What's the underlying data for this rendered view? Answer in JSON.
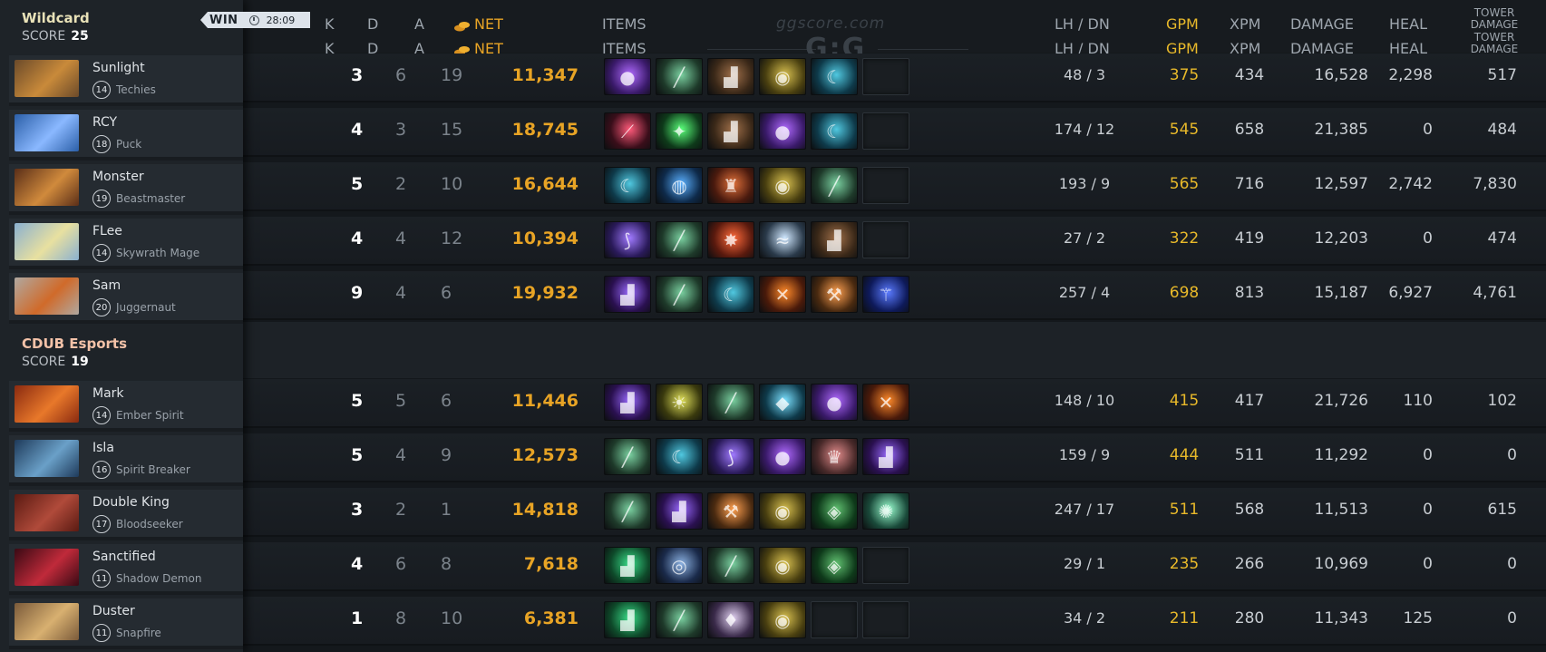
{
  "colors": {
    "gold": "#e8a425",
    "gpm": "#e8b92a",
    "team1_name": "#e9e2b8",
    "team2_name": "#f3c2a8"
  },
  "match": {
    "result": "WIN",
    "duration": "28:09"
  },
  "headers": {
    "k": "K",
    "d": "D",
    "a": "A",
    "net": "NET",
    "items": "ITEMS",
    "lhdn": "LH / DN",
    "gpm": "GPM",
    "xpm": "XPM",
    "damage": "DAMAGE",
    "heal": "HEAL",
    "tower_line1": "TOWER",
    "tower_line2": "DAMAGE"
  },
  "watermark": {
    "text": "ggscore.com",
    "logo": "G:G",
    "logo_sub": "ggscore.com"
  },
  "teams": [
    {
      "name": "Wildcard",
      "score_label": "SCORE",
      "score": "25",
      "players": [
        {
          "name": "Sunlight",
          "level": "14",
          "hero": "Techies",
          "k": "3",
          "d": "6",
          "a": "19",
          "net": "11,347",
          "lhdn": "48 / 3",
          "gpm": "375",
          "xpm": "434",
          "damage": "16,528",
          "heal": "2,298",
          "tower": "517",
          "portrait": [
            "#6b4a2a",
            "#c98a3a"
          ],
          "items": [
            "orb-item-icon",
            "staff-item-icon",
            "boots-item-icon",
            "mask-item-icon",
            "blade-item-icon",
            "empty"
          ]
        },
        {
          "name": "RCY",
          "level": "18",
          "hero": "Puck",
          "k": "4",
          "d": "3",
          "a": "15",
          "net": "18,745",
          "lhdn": "174 / 12",
          "gpm": "545",
          "xpm": "658",
          "damage": "21,385",
          "heal": "0",
          "tower": "484",
          "portrait": [
            "#2b5fa8",
            "#8ab8ff"
          ],
          "items": [
            "dagger-item-icon",
            "gem-item-icon",
            "boots-item-icon",
            "orb-item-icon",
            "blade-item-icon",
            "empty"
          ]
        },
        {
          "name": "Monster",
          "level": "19",
          "hero": "Beastmaster",
          "k": "5",
          "d": "2",
          "a": "10",
          "net": "16,644",
          "lhdn": "193 / 9",
          "gpm": "565",
          "xpm": "716",
          "damage": "12,597",
          "heal": "2,742",
          "tower": "7,830",
          "portrait": [
            "#5a2e18",
            "#d08a3c"
          ],
          "items": [
            "blade-item-icon",
            "globe-item-icon",
            "helm-item-icon",
            "mask-item-icon",
            "staff-item-icon",
            "empty"
          ]
        },
        {
          "name": "FLee",
          "level": "14",
          "hero": "Skywrath Mage",
          "k": "4",
          "d": "4",
          "a": "12",
          "net": "10,394",
          "lhdn": "27 / 2",
          "gpm": "322",
          "xpm": "419",
          "damage": "12,203",
          "heal": "0",
          "tower": "474",
          "portrait": [
            "#8ab0d0",
            "#e8e0a0"
          ],
          "items": [
            "scythe-item-icon",
            "staff-item-icon",
            "shield-item-icon",
            "wind-item-icon",
            "boots-item-icon",
            "empty"
          ]
        },
        {
          "name": "Sam",
          "level": "20",
          "hero": "Juggernaut",
          "k": "9",
          "d": "4",
          "a": "6",
          "net": "19,932",
          "lhdn": "257 / 4",
          "gpm": "698",
          "xpm": "813",
          "damage": "15,187",
          "heal": "6,927",
          "tower": "4,761",
          "portrait": [
            "#b0a8a0",
            "#d06a2a"
          ],
          "items": [
            "boots-purple-item-icon",
            "staff-item-icon",
            "blade-item-icon",
            "crossed-blades-item-icon",
            "axe-item-icon",
            "scepter-item-icon"
          ]
        }
      ]
    },
    {
      "name": "CDUB Esports",
      "score_label": "SCORE",
      "score": "19",
      "players": [
        {
          "name": "Mark",
          "level": "14",
          "hero": "Ember Spirit",
          "k": "5",
          "d": "5",
          "a": "6",
          "net": "11,446",
          "lhdn": "148 / 10",
          "gpm": "415",
          "xpm": "417",
          "damage": "21,726",
          "heal": "110",
          "tower": "102",
          "portrait": [
            "#8a2a10",
            "#e8782a"
          ],
          "items": [
            "boots-purple-item-icon",
            "radiance-item-icon",
            "staff-item-icon",
            "crystal-item-icon",
            "orb-item-icon",
            "crossed-blades-item-icon"
          ]
        },
        {
          "name": "Isla",
          "level": "16",
          "hero": "Spirit Breaker",
          "k": "5",
          "d": "4",
          "a": "9",
          "net": "12,573",
          "lhdn": "159 / 9",
          "gpm": "444",
          "xpm": "511",
          "damage": "11,292",
          "heal": "0",
          "tower": "0",
          "portrait": [
            "#1e3a5a",
            "#6aa0c8"
          ],
          "items": [
            "staff-item-icon",
            "blade-item-icon",
            "scythe-item-icon",
            "orb-item-icon",
            "armor-item-icon",
            "boots-purple-item-icon"
          ]
        },
        {
          "name": "Double King",
          "level": "17",
          "hero": "Bloodseeker",
          "k": "3",
          "d": "2",
          "a": "1",
          "net": "14,818",
          "lhdn": "247 / 17",
          "gpm": "511",
          "xpm": "568",
          "damage": "11,513",
          "heal": "0",
          "tower": "615",
          "portrait": [
            "#5a1a12",
            "#b04a3a"
          ],
          "items": [
            "staff-item-icon",
            "boots-purple-item-icon",
            "axe-item-icon",
            "mask-item-icon",
            "cloak-item-icon",
            "spark-item-icon"
          ]
        },
        {
          "name": "Sanctified",
          "level": "11",
          "hero": "Shadow Demon",
          "k": "4",
          "d": "6",
          "a": "8",
          "net": "7,618",
          "lhdn": "29 / 1",
          "gpm": "235",
          "xpm": "266",
          "damage": "10,969",
          "heal": "0",
          "tower": "0",
          "portrait": [
            "#3a0a14",
            "#c02a3a"
          ],
          "items": [
            "boots-green-item-icon",
            "lens-item-icon",
            "staff-item-icon",
            "mask-item-icon",
            "cloak-item-icon",
            "empty"
          ]
        },
        {
          "name": "Duster",
          "level": "11",
          "hero": "Snapfire",
          "k": "1",
          "d": "8",
          "a": "10",
          "net": "6,381",
          "lhdn": "34 / 2",
          "gpm": "211",
          "xpm": "280",
          "damage": "11,343",
          "heal": "125",
          "tower": "0",
          "portrait": [
            "#7a5a3a",
            "#d8b070"
          ],
          "items": [
            "boots-green-item-icon",
            "staff-item-icon",
            "robe-item-icon",
            "mask-item-icon",
            "empty",
            "empty"
          ]
        }
      ]
    }
  ]
}
